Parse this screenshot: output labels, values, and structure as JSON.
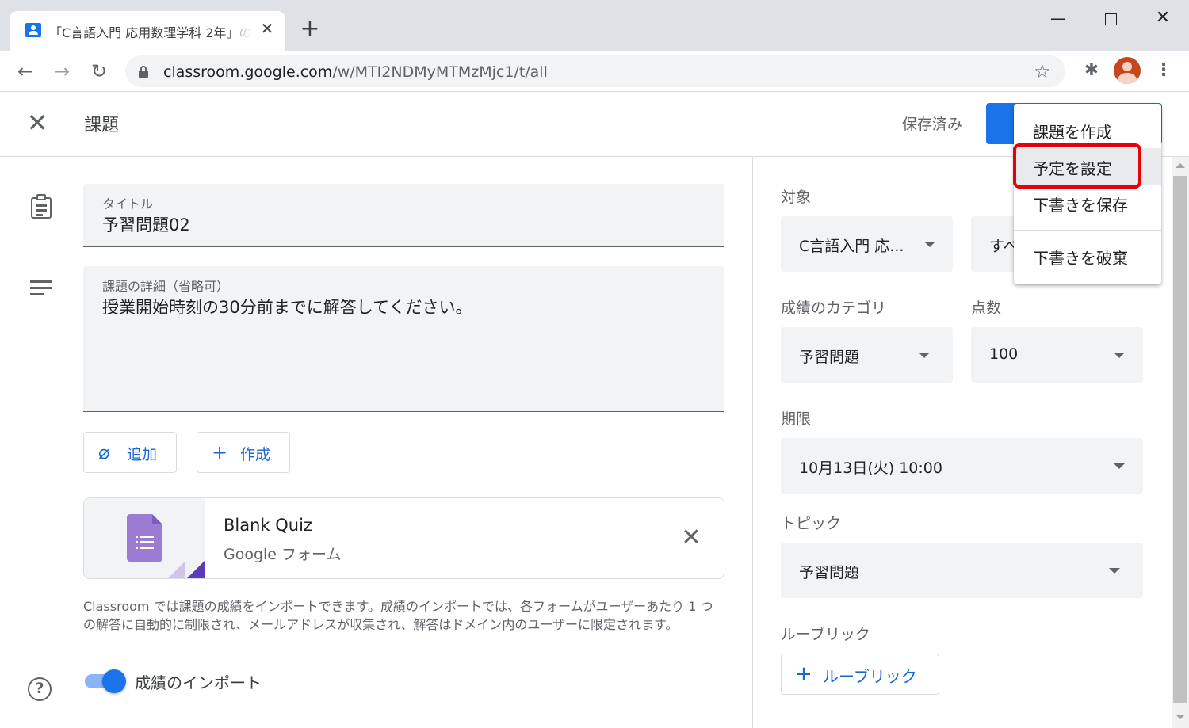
{
  "browser": {
    "tab_title": "「C言語入門 応用数理学科 2年」の",
    "tab_close": "✕",
    "new_tab": "+",
    "window": {
      "minimize": "—",
      "close": "✕"
    },
    "nav": {
      "back": "←",
      "forward": "→",
      "reload": "↻"
    },
    "url_host": "classroom.google.com",
    "url_path": "/w/MTI2NDMyMTMzMjc1/t/all",
    "star": "☆",
    "extensions": "✱",
    "menu": "⋮"
  },
  "header": {
    "close": "✕",
    "title": "課題",
    "saved_status": "保存済み"
  },
  "form": {
    "title_label": "タイトル",
    "title_value": "予習問題02",
    "desc_label": "課題の詳細（省略可）",
    "desc_value": "授業開始時刻の30分前までに解答してください。",
    "add_button": {
      "icon": "⌀",
      "label": "追加"
    },
    "create_button": {
      "icon": "+",
      "label": "作成"
    },
    "attachment": {
      "title": "Blank Quiz",
      "type": "Google フォーム",
      "remove": "✕"
    },
    "import_note": "Classroom では課題の成績をインポートできます。成績のインポートでは、各フォームがユーザーあたり 1 つの解答に自動的に制限され、メールアドレスが収集され、解答はドメイン内のユーザーに限定されます。",
    "import_toggle": {
      "label": "成績のインポート",
      "on": true
    },
    "help": "?"
  },
  "panel": {
    "target_label": "対象",
    "class_select": "C言語入門 応...",
    "students_select": "すべ",
    "grade_category_label": "成績のカテゴリ",
    "grade_category_value": "予習問題",
    "points_label": "点数",
    "points_value": "100",
    "due_label": "期限",
    "due_value": "10月13日(火) 10:00",
    "topic_label": "トピック",
    "topic_value": "予習問題",
    "rubric_label": "ルーブリック",
    "rubric_button": {
      "icon": "+",
      "label": "ルーブリック"
    }
  },
  "dropdown_menu": {
    "items": [
      "課題を作成",
      "予定を設定",
      "下書きを保存",
      "下書きを破棄"
    ],
    "highlighted": "予定を設定"
  },
  "colors": {
    "accent": "#1a73e8",
    "highlight_border": "#e8000b",
    "field_bg": "#f1f3f4"
  }
}
